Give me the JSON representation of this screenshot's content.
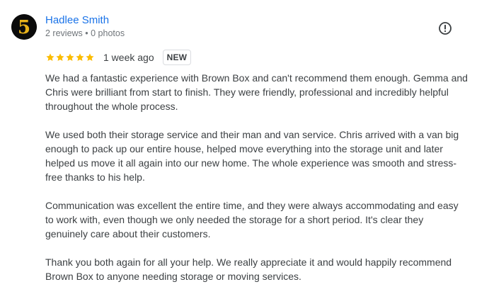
{
  "review": {
    "author": {
      "name": "Hadlee Smith",
      "meta": "2 reviews • 0 photos",
      "avatar_glyph": "5",
      "avatar_colors": {
        "background": "#0b0b0b",
        "glyph": "#e8b21a"
      }
    },
    "rating": {
      "stars": 5,
      "max": 5,
      "color": "#fbbc04"
    },
    "date": "1 week ago",
    "badge": "NEW",
    "report_icon": "exclamation-circle-icon",
    "paragraphs": [
      "We had a fantastic experience with Brown Box and can't recommend them enough. Gemma and Chris were brilliant from start to finish. They were friendly, professional and incredibly helpful throughout the whole process.",
      "We used both their storage service and their man and van service. Chris arrived with a van big enough to pack up our entire house, helped move everything into the storage unit and later helped us move it all again into our new home. The whole experience was smooth and stress-free thanks to his help.",
      "Communication was excellent the entire time, and they were always accommodating and easy to work with, even though we only needed the storage for a short period. It's clear they genuinely care about their customers.",
      "Thank you both again for all your help. We really appreciate it and would happily recommend Brown Box to anyone needing storage or moving services."
    ]
  }
}
